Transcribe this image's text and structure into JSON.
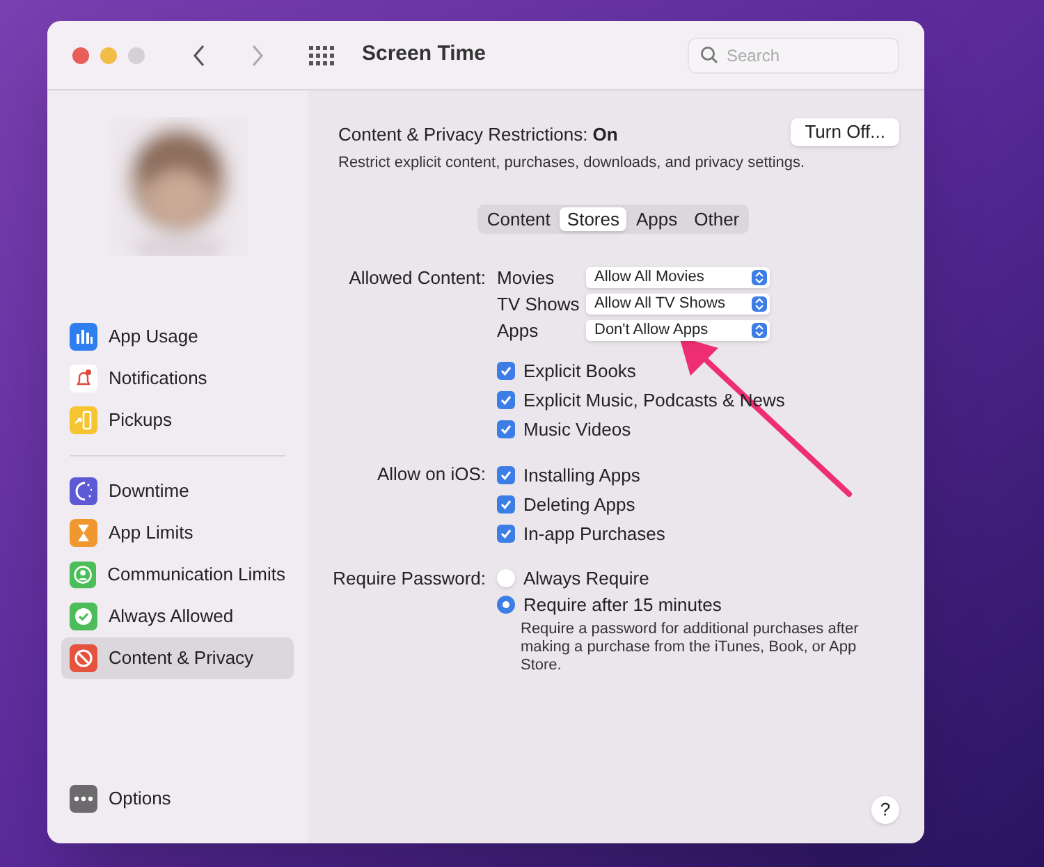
{
  "window": {
    "title": "Screen Time",
    "search": {
      "placeholder": "Search"
    }
  },
  "sidebar": {
    "groups": [
      [
        {
          "label": "App Usage",
          "selected": false
        },
        {
          "label": "Notifications",
          "selected": false
        },
        {
          "label": "Pickups",
          "selected": false
        }
      ],
      [
        {
          "label": "Downtime",
          "selected": false
        },
        {
          "label": "App Limits",
          "selected": false
        },
        {
          "label": "Communication Limits",
          "selected": false
        },
        {
          "label": "Always Allowed",
          "selected": false
        },
        {
          "label": "Content & Privacy",
          "selected": true
        }
      ]
    ],
    "options": {
      "label": "Options"
    }
  },
  "header": {
    "title": "Content & Privacy Restrictions: **On**",
    "button": "Turn Off...",
    "description": "Restrict explicit content, purchases, downloads, and privacy settings."
  },
  "tabs": [
    {
      "label": "Content",
      "selected": false
    },
    {
      "label": "Stores",
      "selected": true
    },
    {
      "label": "Apps",
      "selected": false
    },
    {
      "label": "Other",
      "selected": false
    }
  ],
  "sections": [
    {
      "label": "Allowed Content:",
      "rows": [
        {
          "kind": "popup",
          "label": "Movies",
          "value": "Allow All Movies"
        },
        {
          "kind": "popup",
          "label": "TV Shows",
          "value": "Allow All TV Shows"
        },
        {
          "kind": "popup",
          "label": "Apps",
          "value": "Don't Allow Apps"
        },
        {
          "kind": "checkbox",
          "label": "Explicit Books",
          "checked": true
        },
        {
          "kind": "checkbox",
          "label": "Explicit Music, Podcasts & News",
          "checked": true
        },
        {
          "kind": "checkbox",
          "label": "Music Videos",
          "checked": true
        }
      ]
    },
    {
      "label": "Allow on iOS:",
      "rows": [
        {
          "kind": "checkbox",
          "label": "Installing Apps",
          "checked": true
        },
        {
          "kind": "checkbox",
          "label": "Deleting Apps",
          "checked": true
        },
        {
          "kind": "checkbox",
          "label": "In-app Purchases",
          "checked": true
        }
      ]
    },
    {
      "label": "Require Password:",
      "rows": [
        {
          "kind": "radio",
          "label": "Always Require",
          "selected": false
        },
        {
          "kind": "radio",
          "label": "Require after 15 minutes",
          "selected": true
        },
        {
          "kind": "note",
          "text": "Require a password for additional purchases after making a purchase from the iTunes, Book, or App Store."
        }
      ]
    }
  ],
  "help": {
    "label": "?"
  }
}
